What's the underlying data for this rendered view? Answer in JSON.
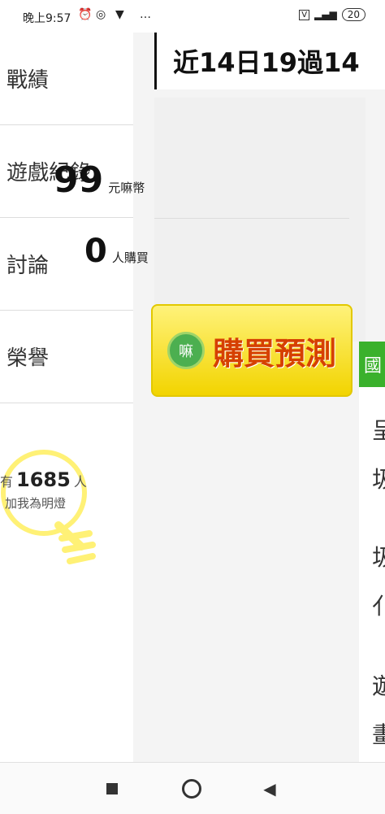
{
  "status": {
    "time": "晚上9:57",
    "battery": "20"
  },
  "sidebar": {
    "items": [
      {
        "label": "戰績"
      },
      {
        "label": "遊戲紀錄"
      },
      {
        "label": "討論"
      },
      {
        "label": "榮譽"
      }
    ],
    "bulb": {
      "prefix": "有",
      "count": "1685",
      "suffix": "人",
      "caption": "加我為明燈"
    }
  },
  "main": {
    "title": "近14日19過14",
    "price": {
      "value": "99",
      "unit": "元嘛幣"
    },
    "buyers": {
      "value": "0",
      "unit": "人購買"
    },
    "buy_button": "購買預測",
    "logo_text": "嘛",
    "green_tab": "國",
    "right_cut": [
      "呈",
      "圾",
      "圾",
      "亻",
      "遊",
      "畫"
    ]
  }
}
